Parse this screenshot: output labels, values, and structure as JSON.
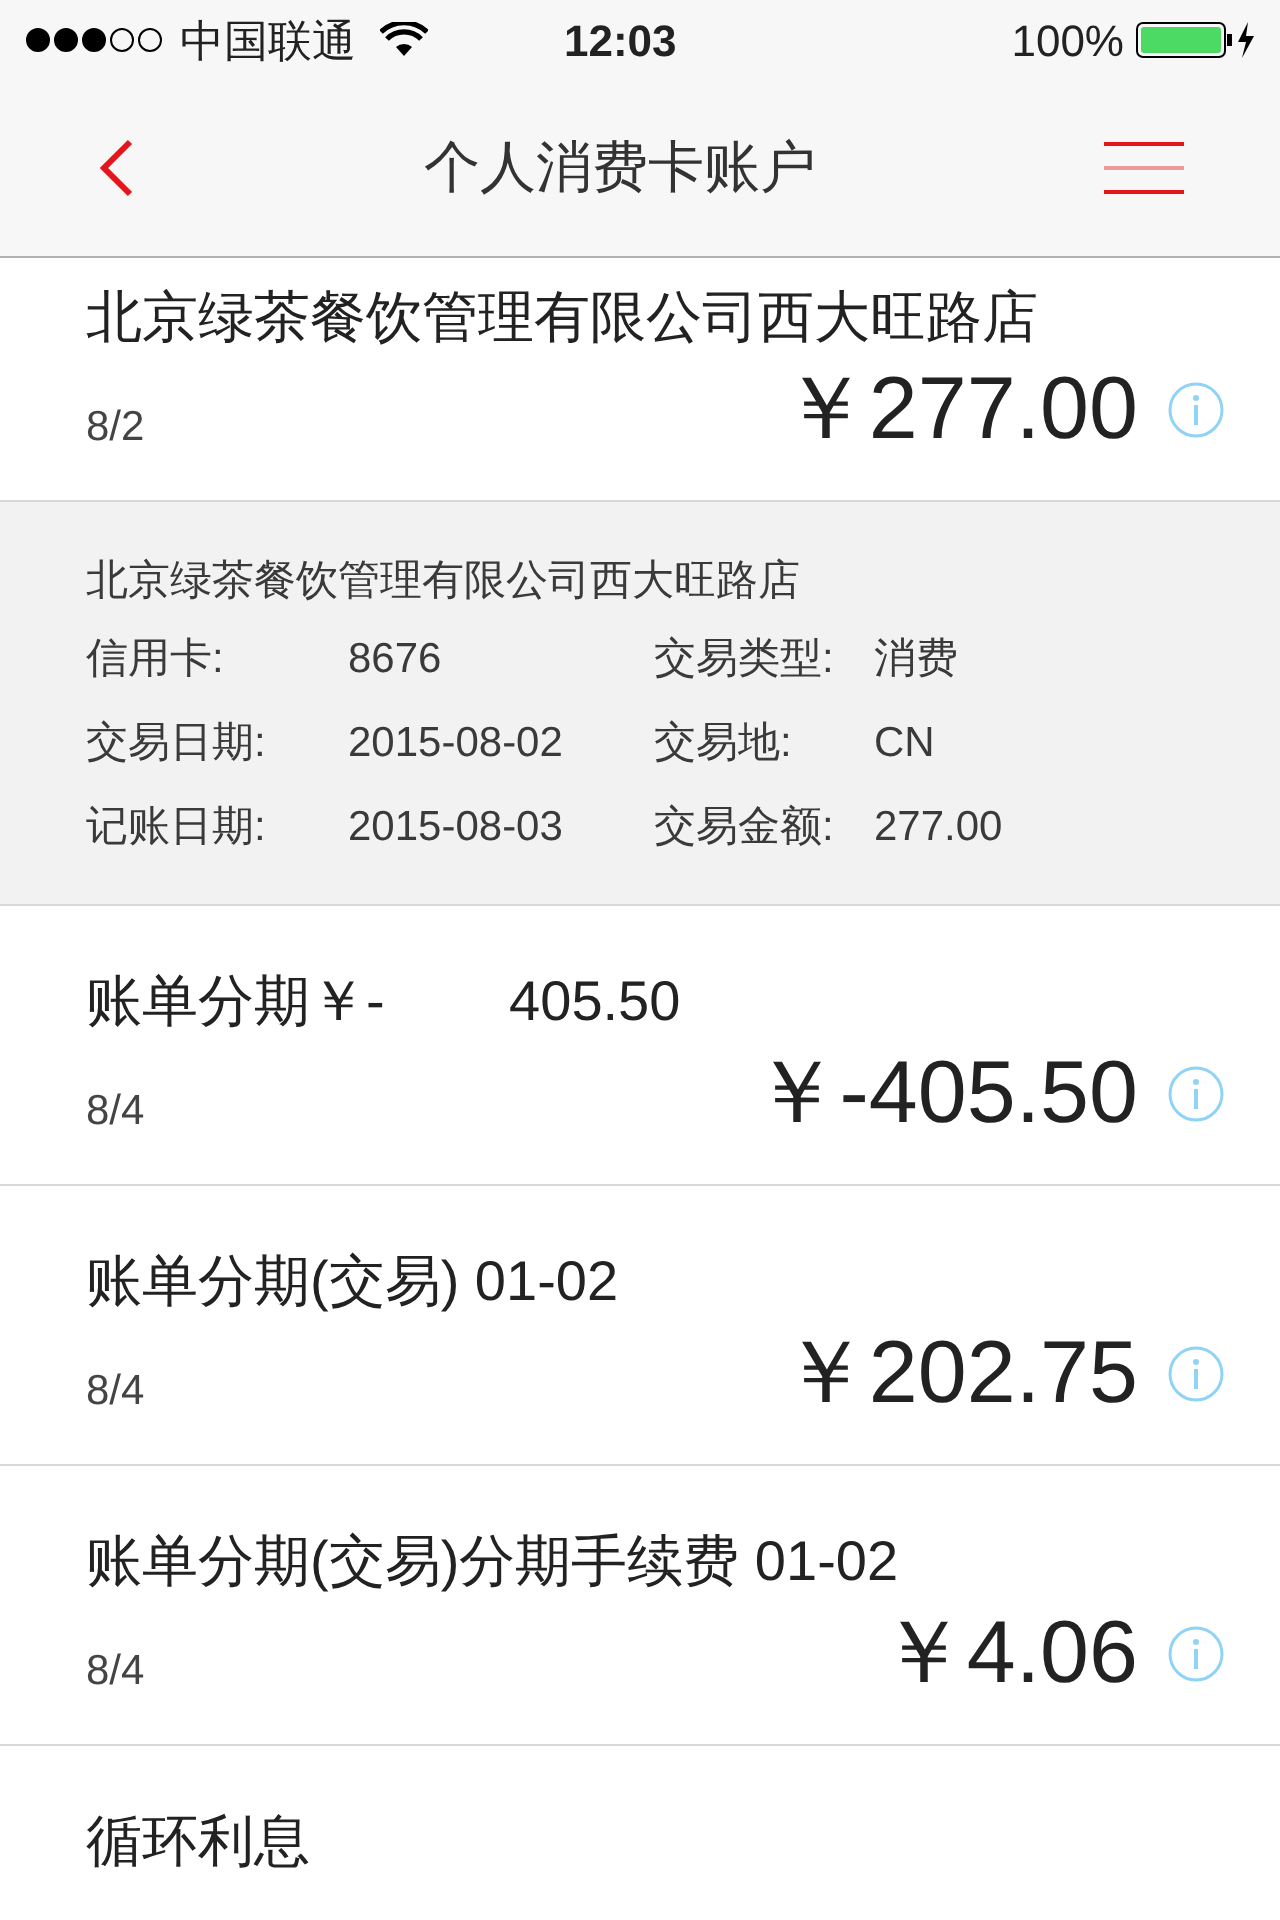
{
  "status_bar": {
    "carrier": "中国联通",
    "time": "12:03",
    "battery": "100%"
  },
  "nav": {
    "title": "个人消费卡账户"
  },
  "transactions": [
    {
      "title": "北京绿茶餐饮管理有限公司西大旺路店",
      "date": "8/2",
      "amount": "￥277.00",
      "detail": {
        "merchant": "北京绿茶餐饮管理有限公司西大旺路店",
        "fields": [
          {
            "label": "信用卡:",
            "value": "8676"
          },
          {
            "label": "交易类型:",
            "value": "消费"
          },
          {
            "label": "交易日期:",
            "value": "2015-08-02"
          },
          {
            "label": "交易地:",
            "value": "CN"
          },
          {
            "label": "记账日期:",
            "value": "2015-08-03"
          },
          {
            "label": "交易金额:",
            "value": "277.00"
          }
        ]
      }
    },
    {
      "title": "账单分期￥-        405.50",
      "date": "8/4",
      "amount": "￥-405.50"
    },
    {
      "title": "账单分期(交易) 01-02",
      "date": "8/4",
      "amount": "￥202.75"
    },
    {
      "title": "账单分期(交易)分期手续费 01-02",
      "date": "8/4",
      "amount": "￥4.06"
    },
    {
      "title": "循环利息"
    }
  ]
}
